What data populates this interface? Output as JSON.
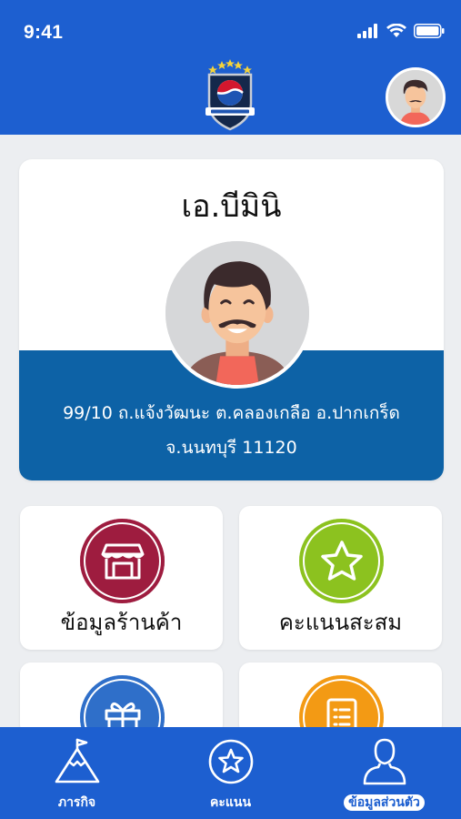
{
  "status_bar": {
    "time": "9:41"
  },
  "header": {
    "logo_icon": "pepsi-badge-logo",
    "avatar_icon": "user-avatar"
  },
  "profile": {
    "name": "เอ.บีมินิ",
    "address_line1": "99/10 ถ.แจ้งวัฒนะ ต.คลองเกลือ อ.ปากเกร็ด",
    "address_line2": "จ.นนทบุรี 11120"
  },
  "tiles": [
    {
      "label": "ข้อมูลร้านค้า",
      "icon": "shop-icon",
      "color": "#9e1c3f"
    },
    {
      "label": "คะแนนสะสม",
      "icon": "star-icon",
      "color": "#8cc21f"
    },
    {
      "label": "",
      "icon": "gift-icon",
      "color": "#2f6fc9"
    },
    {
      "label": "",
      "icon": "list-icon",
      "color": "#f39a14"
    }
  ],
  "bottom_nav": [
    {
      "label": "ภารกิจ",
      "icon": "mountain-flag-icon"
    },
    {
      "label": "คะแนน",
      "icon": "star-circle-icon"
    },
    {
      "label": "ข้อมูลส่วนตัว",
      "icon": "person-icon",
      "active": true
    }
  ],
  "colors": {
    "primary": "#1d5fd0",
    "band": "#0d62a6",
    "background": "#eceef1"
  }
}
